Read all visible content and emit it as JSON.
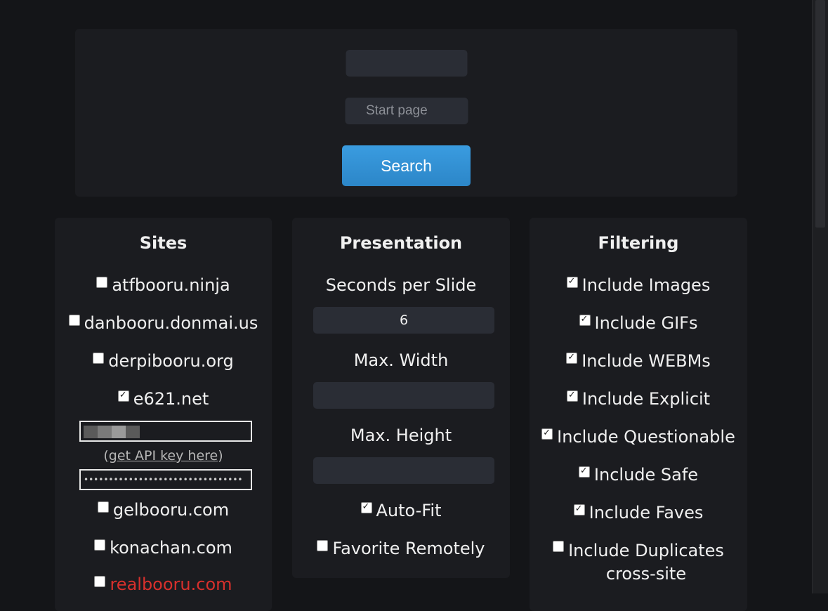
{
  "search": {
    "query_value": "",
    "start_page_placeholder": "Start page",
    "button_label": "Search"
  },
  "sites": {
    "title": "Sites",
    "items": [
      {
        "label": "atfbooru.ninja",
        "checked": false
      },
      {
        "label": "danbooru.donmai.us",
        "checked": false
      },
      {
        "label": "derpibooru.org",
        "checked": false
      },
      {
        "label": "e621.net",
        "checked": true
      },
      {
        "label": "gelbooru.com",
        "checked": false
      },
      {
        "label": "konachan.com",
        "checked": false
      },
      {
        "label": "realbooru.com",
        "checked": false
      }
    ],
    "api_link_open": "(",
    "api_link_text": "get API key here",
    "api_link_close": ")",
    "api_key_masked": "••••••••••••••••••••••••••••••••"
  },
  "presentation": {
    "title": "Presentation",
    "seconds_label": "Seconds per Slide",
    "seconds_value": "6",
    "max_width_label": "Max. Width",
    "max_width_value": "",
    "max_height_label": "Max. Height",
    "max_height_value": "",
    "autofit_label": "Auto-Fit",
    "autofit_checked": true,
    "favorite_label": "Favorite Remotely",
    "favorite_checked": false
  },
  "filtering": {
    "title": "Filtering",
    "items": [
      {
        "label": "Include Images",
        "checked": true
      },
      {
        "label": "Include GIFs",
        "checked": true
      },
      {
        "label": "Include WEBMs",
        "checked": true
      },
      {
        "label": "Include Explicit",
        "checked": true
      },
      {
        "label": "Include Questionable",
        "checked": true
      },
      {
        "label": "Include Safe",
        "checked": true
      },
      {
        "label": "Include Faves",
        "checked": true
      }
    ],
    "duplicates_line1": "Include Duplicates",
    "duplicates_line2": "cross-site",
    "duplicates_checked": false
  },
  "colors": {
    "background": "#141518",
    "panel": "#1b1c20",
    "input": "#2a2d35",
    "accent": "#2c86c8",
    "warning_text": "#d8302c"
  }
}
